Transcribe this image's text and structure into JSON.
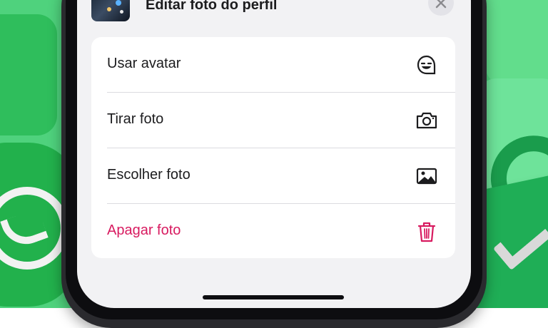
{
  "header": {
    "title": "Editar foto do perfil",
    "close_icon": "close-icon"
  },
  "menu": {
    "items": [
      {
        "label": "Usar avatar",
        "icon": "avatar-icon",
        "destructive": false
      },
      {
        "label": "Tirar foto",
        "icon": "camera-icon",
        "destructive": false
      },
      {
        "label": "Escolher foto",
        "icon": "photo-icon",
        "destructive": false
      },
      {
        "label": "Apagar foto",
        "icon": "trash-icon",
        "destructive": true
      }
    ]
  },
  "colors": {
    "destructive": "#d81b60",
    "background_green": "#4fd27d",
    "sheet_background": "#f2f2f4"
  }
}
